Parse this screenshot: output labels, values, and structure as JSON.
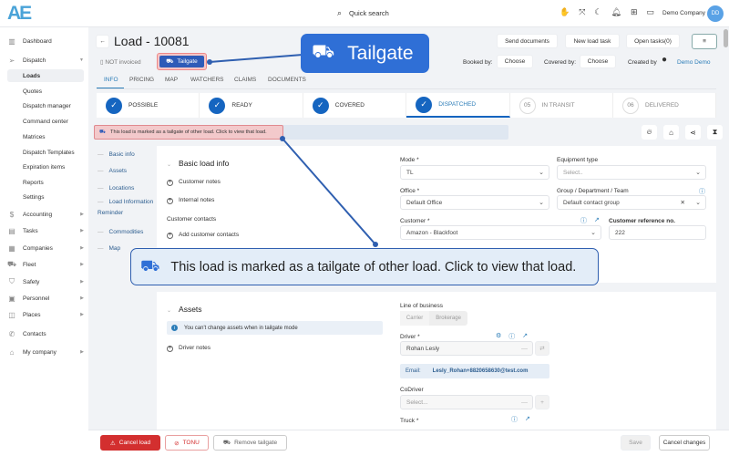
{
  "header": {
    "logo": "AE",
    "search_label": "Quick search",
    "company": "Demo Company",
    "avatar": "DD"
  },
  "sidebar": {
    "items": [
      {
        "label": "Dashboard",
        "icon": "chart-icon"
      },
      {
        "label": "Dispatch",
        "icon": "send-icon",
        "expanded": true
      },
      {
        "label": "Loads",
        "sub": true,
        "active": true
      },
      {
        "label": "Quotes",
        "sub": true
      },
      {
        "label": "Dispatch manager",
        "sub": true
      },
      {
        "label": "Command center",
        "sub": true
      },
      {
        "label": "Matrices",
        "sub": true
      },
      {
        "label": "Dispatch Templates",
        "sub": true
      },
      {
        "label": "Expiration items",
        "sub": true
      },
      {
        "label": "Reports",
        "sub": true
      },
      {
        "label": "Settings",
        "sub": true
      },
      {
        "label": "Accounting",
        "icon": "dollar-icon",
        "arrow": true
      },
      {
        "label": "Tasks",
        "icon": "tasks-icon",
        "arrow": true
      },
      {
        "label": "Companies",
        "icon": "building-icon",
        "arrow": true
      },
      {
        "label": "Fleet",
        "icon": "truck-icon",
        "arrow": true
      },
      {
        "label": "Safety",
        "icon": "shield-icon",
        "arrow": true
      },
      {
        "label": "Personnel",
        "icon": "id-card-icon",
        "arrow": true
      },
      {
        "label": "Places",
        "icon": "map-icon",
        "arrow": true
      },
      {
        "label": "Contacts",
        "icon": "phone-icon"
      },
      {
        "label": "My company",
        "icon": "home-icon",
        "arrow": true
      }
    ]
  },
  "page": {
    "title": "Load - 10081",
    "invoice_status": "NOT invoiced",
    "tailgate_label": "Tailgate",
    "actions": {
      "send_documents": "Send documents",
      "new_load_task": "New load task",
      "open_tasks": "Open tasks(0)"
    },
    "booked_by_label": "Booked by:",
    "booked_by": "Choose",
    "covered_by_label": "Covered by:",
    "covered_by": "Choose",
    "created_by_label": "Created by",
    "created_by": "Demo Demo"
  },
  "tabs": [
    "INFO",
    "PRICING",
    "MAP",
    "WATCHERS",
    "CLAIMS",
    "DOCUMENTS"
  ],
  "steps": [
    {
      "label": "POSSIBLE",
      "done": true
    },
    {
      "label": "READY",
      "done": true
    },
    {
      "label": "COVERED",
      "done": true
    },
    {
      "label": "DISPATCHED",
      "done": true
    },
    {
      "label": "IN TRANSIT",
      "num": "05"
    },
    {
      "label": "DELIVERED",
      "num": "06"
    }
  ],
  "alert": "This load is marked as a tailgate of other load. Click to view that load.",
  "subnav": [
    "Basic info",
    "Assets",
    "Locations",
    "Load Information Reminder",
    "Commodities",
    "Map"
  ],
  "basic": {
    "title": "Basic load info",
    "customer_notes": "Customer notes",
    "internal_notes": "Internal notes",
    "customer_contacts": "Customer contacts",
    "add_contacts": "Add customer contacts",
    "mode_label": "Mode *",
    "mode": "TL",
    "equipment_label": "Equipment type",
    "equipment_placeholder": "Select..",
    "office_label": "Office *",
    "office": "Default Office",
    "group_label": "Group / Department / Team",
    "group": "Default contact group",
    "customer_label": "Customer *",
    "customer": "Amazon - Blackfoot",
    "ref_label": "Customer reference no.",
    "ref": "222"
  },
  "assets": {
    "title": "Assets",
    "info": "You can't change assets when in tailgate mode",
    "driver_notes": "Driver notes",
    "lob_label": "Line of business",
    "lob_options": [
      "Carrier",
      "Brokerage"
    ],
    "driver_label": "Driver *",
    "driver": "Rohan Lesly",
    "email_label": "Email:",
    "email": "Lesly_Rohan+8820658630@test.com",
    "codriver_label": "CoDriver",
    "codriver_placeholder": "Select...",
    "truck_label": "Truck *"
  },
  "footer": {
    "cancel_load": "Cancel load",
    "tonu": "TONU",
    "remove_tailgate": "Remove tailgate",
    "save": "Save",
    "cancel_changes": "Cancel changes"
  },
  "callouts": {
    "tailgate": "Tailgate",
    "alert": "This load is marked as a tailgate of other load. Click to view that load."
  },
  "colors": {
    "primary": "#1565c0",
    "callout": "#2f6fd6",
    "danger": "#d32f2f"
  }
}
